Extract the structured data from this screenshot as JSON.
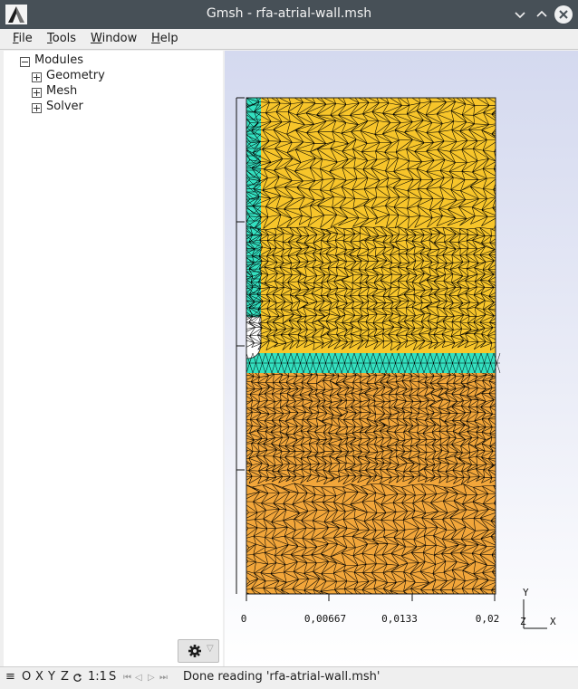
{
  "window": {
    "title": "Gmsh - rfa-atrial-wall.msh",
    "logo_icon": "gmsh-logo-icon",
    "controls": [
      "minimize-icon",
      "maximize-icon",
      "close-icon"
    ]
  },
  "menu": {
    "file": {
      "mnemonic": "F",
      "rest": "ile"
    },
    "tools": {
      "mnemonic": "T",
      "rest": "ools"
    },
    "window": {
      "mnemonic": "W",
      "rest": "indow"
    },
    "help": {
      "mnemonic": "H",
      "rest": "elp"
    }
  },
  "tree": {
    "root": {
      "label": "Modules",
      "state": "expanded"
    },
    "children": [
      {
        "label": "Geometry",
        "state": "collapsed"
      },
      {
        "label": "Mesh",
        "state": "collapsed"
      },
      {
        "label": "Solver",
        "state": "collapsed"
      }
    ]
  },
  "gear_button": {
    "icon": "gear-icon",
    "caret_icon": "caret-down-icon"
  },
  "graphic": {
    "x_ticks": [
      "0",
      "0,00667",
      "0,0133",
      "0,02"
    ],
    "axes_triad": {
      "y": "Y",
      "z": "Z",
      "x": "X"
    },
    "colors": {
      "upper_region": "#f7c52a",
      "lower_region": "#f2a63a",
      "wall_region": "#33e0c0",
      "mesh_lines": "#000000"
    }
  },
  "statusbar": {
    "menu_icon": "≡",
    "view_buttons": [
      "O",
      "X",
      "Y",
      "Z"
    ],
    "rotate_icon": "rotate-icon",
    "scale": "1:1",
    "s_label": "S",
    "playback_icons": [
      "⏮",
      "◁",
      "▷",
      "⏭"
    ],
    "message": "Done reading 'rfa-atrial-wall.msh'"
  }
}
